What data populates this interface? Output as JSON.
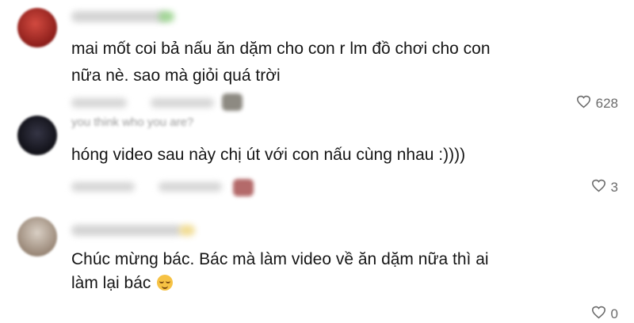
{
  "comments": [
    {
      "lines": [
        "mai mốt coi bả nấu ăn dặm cho con r lm đồ chơi cho con",
        "nữa nè. sao mà giỏi quá trời"
      ],
      "likes": "628",
      "avatar_color": "#b0302a"
    },
    {
      "reply_ghost": "you think who you are?",
      "lines": [
        "hóng video sau này chị út với con nấu cùng nhau :))))"
      ],
      "likes": "3",
      "avatar_color": "#1e1e28"
    },
    {
      "lines": [
        "Chúc mừng bác. Bác mà làm video về ăn dặm nữa thì ai",
        "làm lại bác"
      ],
      "emoji": "relieved-face-emoji",
      "likes": "0",
      "avatar_color": "#b7a89a"
    }
  ],
  "icons": {
    "like": "heart-outline-icon"
  }
}
